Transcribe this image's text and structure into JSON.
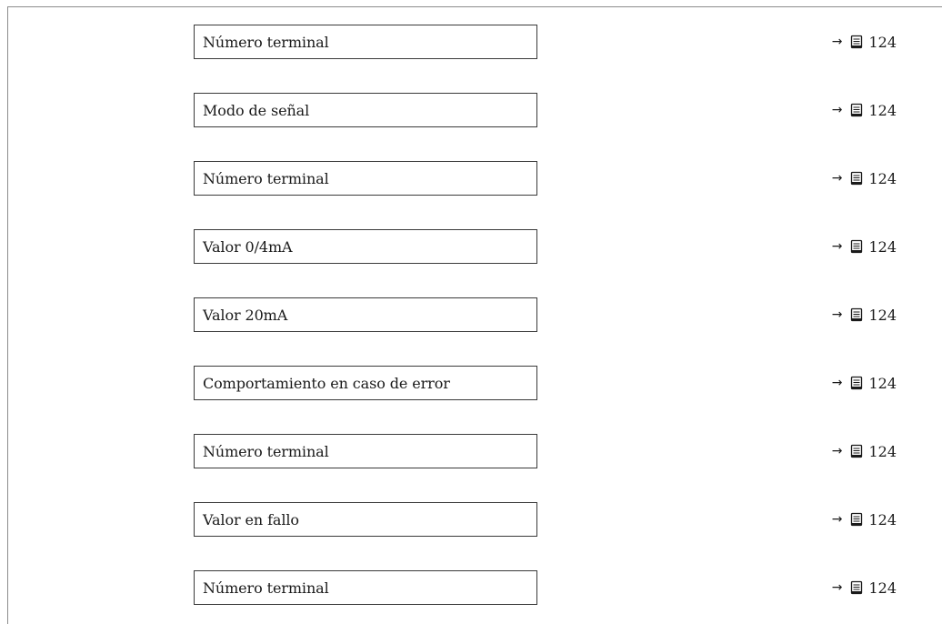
{
  "rows": [
    {
      "label": "Número terminal",
      "page": "124"
    },
    {
      "label": "Modo de señal",
      "page": "124"
    },
    {
      "label": "Número terminal",
      "page": "124"
    },
    {
      "label": "Valor 0/4mA",
      "page": "124"
    },
    {
      "label": "Valor 20mA",
      "page": "124"
    },
    {
      "label": "Comportamiento en caso de error",
      "page": "124"
    },
    {
      "label": "Número terminal",
      "page": "124"
    },
    {
      "label": "Valor en fallo",
      "page": "124"
    },
    {
      "label": "Número terminal",
      "page": "124"
    }
  ],
  "ref_arrow": "→",
  "icons": {
    "page_ref": "book-icon"
  }
}
